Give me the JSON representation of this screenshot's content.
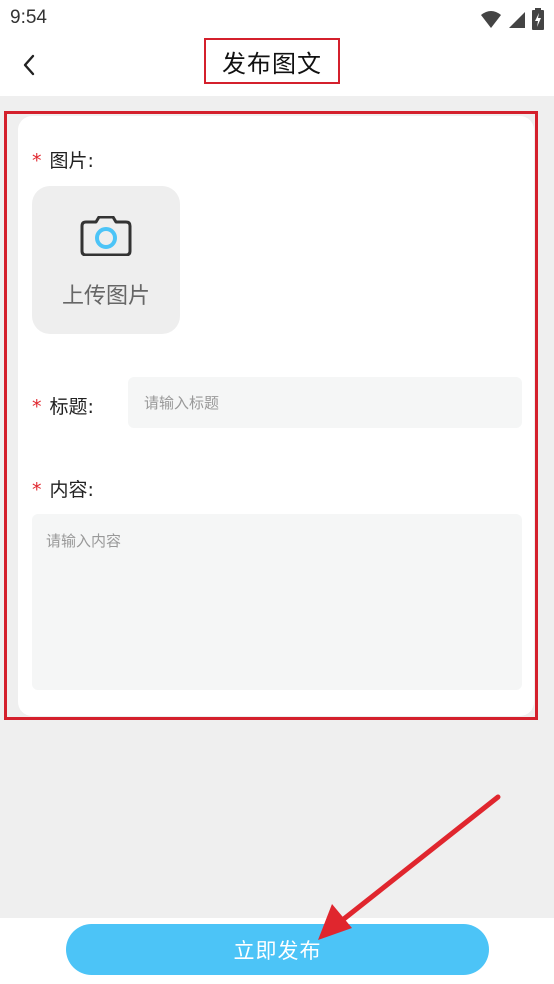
{
  "status": {
    "time": "9:54"
  },
  "nav": {
    "title": "发布图文"
  },
  "form": {
    "image_label": "图片:",
    "upload_label": "上传图片",
    "title_label": "标题:",
    "title_placeholder": "请输入标题",
    "title_value": "",
    "content_label": "内容:",
    "content_placeholder": "请输入内容",
    "content_value": "",
    "required_mark": "*"
  },
  "actions": {
    "publish_label": "立即发布"
  },
  "icons": {
    "back": "chevron-left-icon",
    "camera": "camera-icon",
    "wifi": "wifi-icon",
    "signal": "signal-icon",
    "battery": "battery-icon"
  },
  "colors": {
    "accent": "#4cc4f7",
    "required": "#e0262e",
    "annotation": "#d4202c"
  }
}
